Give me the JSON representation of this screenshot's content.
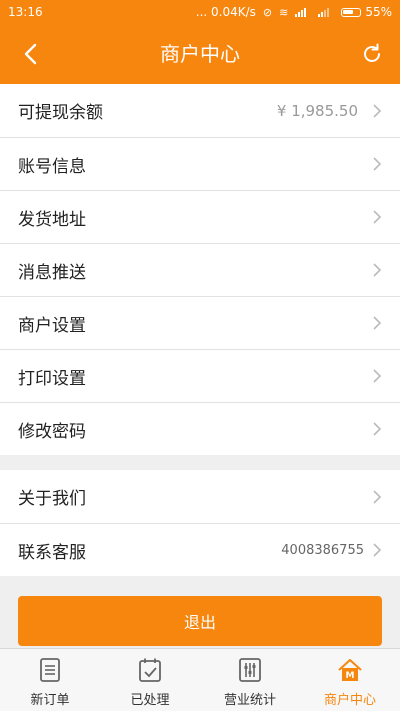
{
  "status_bar": {
    "time": "13:16",
    "network_speed": "... 0.04K/s",
    "battery": "55%"
  },
  "header": {
    "title": "商户中心",
    "back_icon": "chevron-left-icon",
    "refresh_icon": "refresh-icon"
  },
  "menu": {
    "balance": {
      "label": "可提现余额",
      "value": "¥ 1,985.50"
    },
    "account": {
      "label": "账号信息"
    },
    "address": {
      "label": "发货地址"
    },
    "push": {
      "label": "消息推送"
    },
    "merchant": {
      "label": "商户设置"
    },
    "print": {
      "label": "打印设置"
    },
    "password": {
      "label": "修改密码"
    },
    "about": {
      "label": "关于我们"
    },
    "support": {
      "label": "联系客服",
      "value": "4008386755"
    }
  },
  "logout": {
    "label": "退出"
  },
  "tabs": [
    {
      "label": "新订单",
      "icon": "order-list-icon"
    },
    {
      "label": "已处理",
      "icon": "calendar-check-icon"
    },
    {
      "label": "营业统计",
      "icon": "sliders-icon"
    },
    {
      "label": "商户中心",
      "icon": "merchant-home-icon",
      "active": true
    }
  ],
  "colors": {
    "accent": "#f6860e",
    "background": "#efefef"
  }
}
